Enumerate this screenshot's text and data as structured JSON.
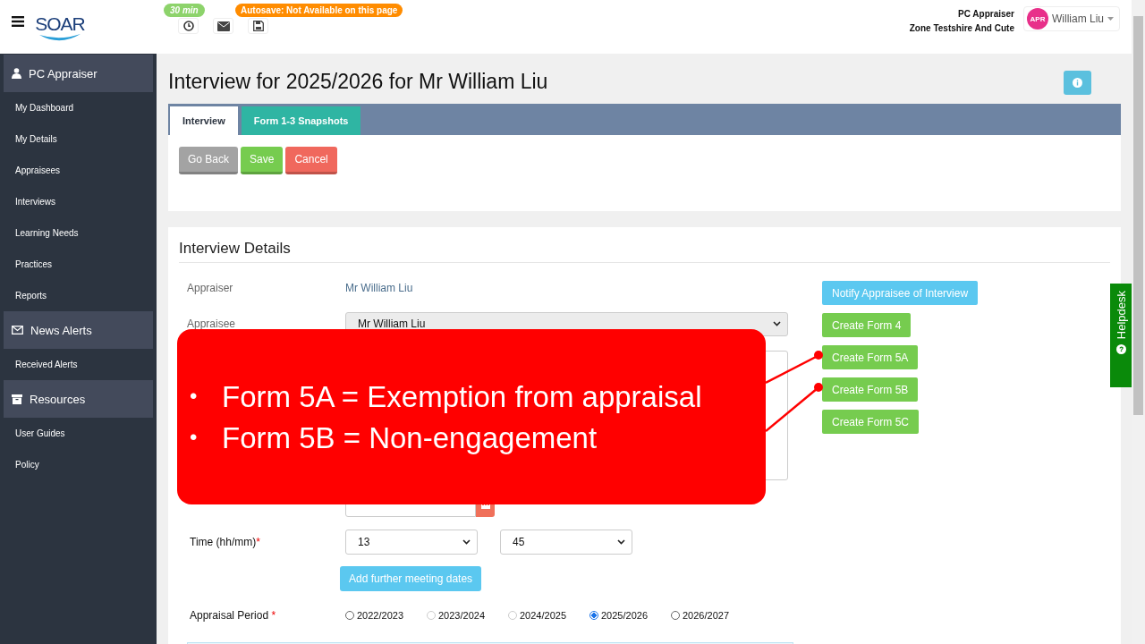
{
  "header": {
    "logo": "SOAR",
    "timer_badge": "30 min",
    "autosave_badge": "Autosave: Not Available on this page",
    "role": "PC Appraiser",
    "zone": "Zone Testshire And Cute",
    "user": {
      "initials": "APR",
      "name": "William Liu"
    }
  },
  "sidebar": {
    "sections": [
      {
        "title": "PC Appraiser",
        "items": [
          "My Dashboard",
          "My Details",
          "Appraisees",
          "Interviews",
          "Learning Needs",
          "Practices",
          "Reports"
        ]
      },
      {
        "title": "News Alerts",
        "items": [
          "Received Alerts"
        ]
      },
      {
        "title": "Resources",
        "items": [
          "User Guides",
          "Policy"
        ]
      }
    ]
  },
  "page": {
    "title": "Interview for 2025/2026 for Mr William Liu",
    "tabs": [
      {
        "label": "Interview",
        "selected": true
      },
      {
        "label": "Form 1-3 Snapshots",
        "selected": false
      }
    ],
    "buttons": [
      {
        "label": "Go Back",
        "kind": "default"
      },
      {
        "label": "Save",
        "kind": "success"
      },
      {
        "label": "Cancel",
        "kind": "danger"
      }
    ],
    "details": {
      "heading": "Interview Details",
      "appraiser_label": "Appraiser",
      "appraiser_value": "Mr William Liu",
      "appraisee_label": "Appraisee",
      "appraisee_value": "Mr William Liu",
      "time_label": "Time (hh/mm)",
      "time_required_mark": "*",
      "time_hours": "13",
      "time_minutes": "45",
      "add_button": "Add further meeting dates",
      "period_label": "Appraisal Period",
      "period_required_mark": "*",
      "periods": [
        {
          "label": "2022/2023",
          "selected": false,
          "disabled": false
        },
        {
          "label": "2023/2024",
          "selected": false,
          "disabled": true
        },
        {
          "label": "2024/2025",
          "selected": false,
          "disabled": true
        },
        {
          "label": "2025/2026",
          "selected": true,
          "disabled": false
        },
        {
          "label": "2026/2027",
          "selected": false,
          "disabled": false
        }
      ]
    },
    "actions": [
      {
        "label": "Notify Appraisee of Interview",
        "kind": "info"
      },
      {
        "label": "Create Form 4",
        "kind": "success"
      },
      {
        "label": "Create Form 5A",
        "kind": "success"
      },
      {
        "label": "Create Form 5B",
        "kind": "success"
      },
      {
        "label": "Create Form 5C",
        "kind": "success"
      }
    ]
  },
  "helpdesk": "Helpdesk",
  "callout": {
    "items": [
      {
        "bullet": "•",
        "text": "Form 5A = Exemption from appraisal"
      },
      {
        "bullet": "•",
        "text": "Form 5B = Non-engagement"
      }
    ]
  }
}
